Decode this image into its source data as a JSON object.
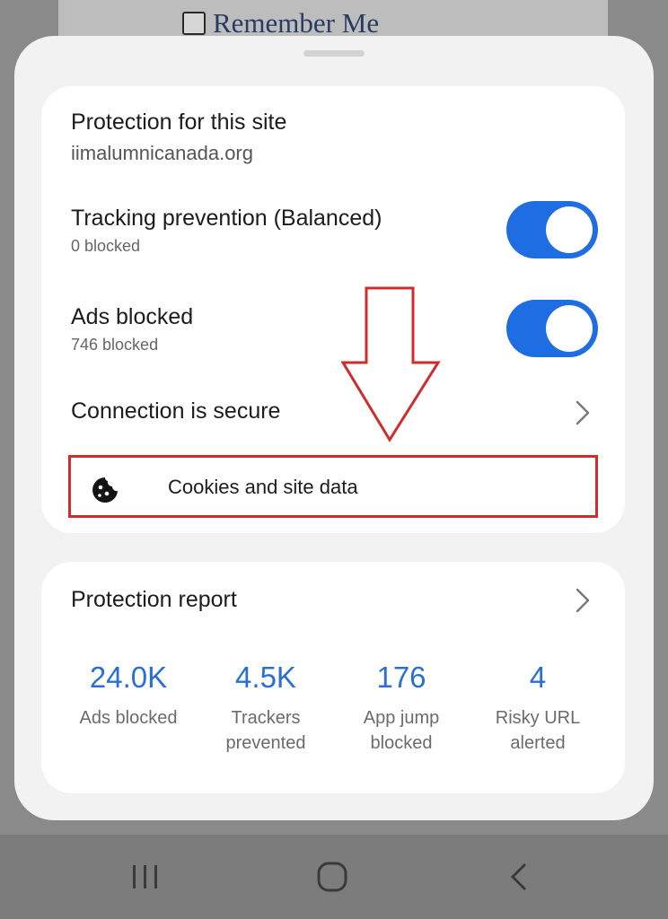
{
  "background": {
    "remember_me": "Remember Me"
  },
  "protection": {
    "title": "Protection for this site",
    "domain": "iimalumnicanada.org",
    "tracking": {
      "label": "Tracking prevention (Balanced)",
      "count": "0 blocked",
      "enabled": true
    },
    "ads": {
      "label": "Ads blocked",
      "count": "746 blocked",
      "enabled": true
    },
    "connection": {
      "label": "Connection is secure"
    },
    "cookies": {
      "label": "Cookies and site data",
      "icon": "cookie-icon"
    }
  },
  "report": {
    "title": "Protection report",
    "stats": [
      {
        "value": "24.0K",
        "label": "Ads blocked"
      },
      {
        "value": "4.5K",
        "label": "Trackers\nprevented"
      },
      {
        "value": "176",
        "label": "App jump\nblocked"
      },
      {
        "value": "4",
        "label": "Risky URL\nalerted"
      }
    ]
  },
  "colors": {
    "accent": "#1e6de3",
    "stat_value": "#2a6fd6",
    "highlight": "#d22b2b"
  },
  "navigation": [
    "recent-apps-icon",
    "home-icon",
    "back-icon"
  ]
}
